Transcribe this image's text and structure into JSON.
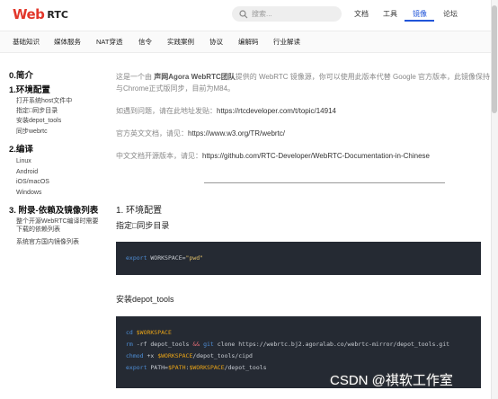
{
  "header": {
    "logo": {
      "web": "Web",
      "rtc": "RTC"
    },
    "search_placeholder": "搜索...",
    "nav": [
      {
        "label": "文档",
        "active": false
      },
      {
        "label": "工具",
        "active": false
      },
      {
        "label": "镜像",
        "active": true
      },
      {
        "label": "论坛",
        "active": false
      }
    ]
  },
  "categories": [
    "基础知识",
    "媒体服务",
    "NAT穿透",
    "信令",
    "实践案例",
    "协议",
    "编解码",
    "行业解读"
  ],
  "toc": {
    "sections": [
      {
        "title": "0.简介",
        "items": []
      },
      {
        "title": "1.环境配置",
        "items": [
          "打开系统host文件中",
          "指定□同步目录",
          "安装depot_tools",
          "同步webrtc"
        ]
      },
      {
        "title": "2.编译",
        "items": [
          "Linux",
          "Android",
          "iOS/macOS",
          "Windows"
        ]
      },
      {
        "title": "3. 附录-依赖及镜像列表",
        "items": [
          "整个开源WebRTC编译时需要下载的依赖列表",
          "系统官方国内镜像列表"
        ]
      }
    ]
  },
  "content": {
    "intro_line1_pre": "这是一个由 ",
    "intro_line1_bold": "声网Agora WebRTC团队",
    "intro_line1_post": "提供的 WebRTC 镜像源，你可以使用此版本代替 Google 官方版本，此镜像保持",
    "intro_line2": "与Chrome正式版同步，目前为M84。",
    "issue_label": "如遇到问题，请在此地址发贴：",
    "issue_link": "https://rtcdeveloper.com/t/topic/14914",
    "doc_en_label": "官方英文文档，请见：",
    "doc_en_link": "https://www.w3.org/TR/webrtc/",
    "doc_cn_label": "中文文档开源版本，请见：",
    "doc_cn_link": "https://github.com/RTC-Developer/WebRTC-Documentation-in-Chinese",
    "section1_title": "1. 环境配置",
    "sub1": "指定□同步目录",
    "code1": {
      "kw": "export",
      "text": " WORKSPACE=",
      "str": "\"pwd\""
    },
    "sub2": "安装depot_tools",
    "code2": {
      "l1_kw": "cd",
      "l1_var": " $WORKSPACE",
      "l2_kw": "rm",
      "l2_a": " -rf depot_tools ",
      "l2_op": "&&",
      "l2_kw2": " git",
      "l2_b": " clone https://webrtc.bj2.agoralab.co/webrtc-mirror/depot_tools.git",
      "l3_kw": "chmod",
      "l3_a": " +x ",
      "l3_var": "$WORKSPACE",
      "l3_b": "/depot_tools/cipd",
      "l4_kw": "export",
      "l4_a": " PATH=",
      "l4_var": "$PATH",
      "l4_b": ":",
      "l4_var2": "$WORKSPACE",
      "l4_c": "/depot_tools"
    }
  },
  "watermark": "CSDN @祺软工作室",
  "colors": {
    "accent": "#2155d9",
    "logo_red": "#e2372b",
    "code_bg": "#252a33"
  }
}
